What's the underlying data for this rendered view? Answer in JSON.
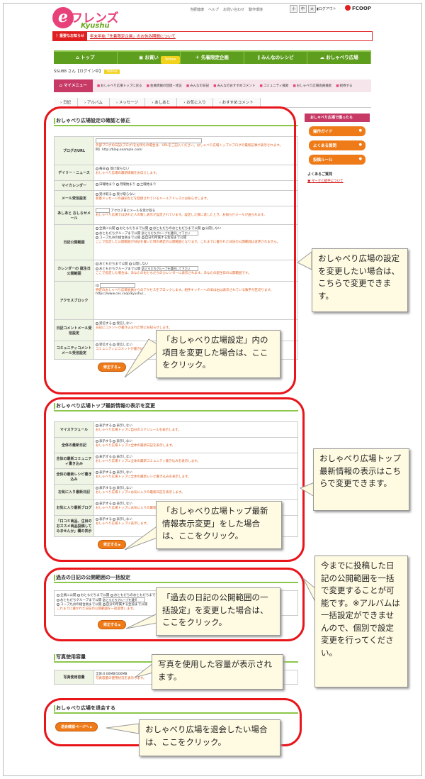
{
  "header": {
    "logo_text": "フレンズ",
    "logo_sub": "Kyushu",
    "top_links": [
      "当経健康",
      "ヘルプ",
      "お問い合わせ",
      "動作環境"
    ],
    "font_sizes": [
      "小",
      "中",
      "大"
    ],
    "logout": "ログアウト",
    "brand": "FCOOP"
  },
  "notice": {
    "label": "！重要なお知らせ",
    "text": "年末年始「先着限定企画」のお休み期間について"
  },
  "nav": {
    "items": [
      "トップ",
      "お買い",
      "先着限定企画",
      "みんなのレシピ",
      "おしゃべり広場"
    ],
    "badge": "Yellow"
  },
  "user": {
    "name": "SSU88 さん【ログイン中】",
    "badge": "Yellow"
  },
  "mymenu": {
    "label": "マイメニュー",
    "links": [
      "おしゃべり広場トップに戻る",
      "会員情報の登録・修正",
      "みんなの日記",
      "みんなのおすすめコメント",
      "コミュニティ検索",
      "おしゃべり広場会員検索",
      "招待する"
    ]
  },
  "tabs": [
    "日記",
    "アルバム",
    "メッセージ",
    "あしあと",
    "お気に入り",
    "おすすめコメント"
  ],
  "sec1": {
    "title": "おしゃべり広場設定の確認と修正",
    "rows": [
      {
        "label": "ブログのURL",
        "text": "外部ブログの日記(ブログ)をお持ちの場合は、URLをご記入ください。おしゃべり広場トップにブログの最新記事が表示されます。",
        "example": "例）http://blog.example.com/"
      },
      {
        "label": "デイリー・ニュース",
        "opts": [
          "毎日",
          "受け取らない"
        ],
        "text": "おしゃべり広場の最新情報をお伝えします。"
      },
      {
        "label": "マイカレンダー",
        "opts": [
          "日曜始まり",
          "月曜始まり",
          "土曜始まり"
        ],
        "text": ""
      },
      {
        "label": "メール受信設定",
        "opts": [
          "受け取る",
          "受け取らない"
        ],
        "text": "新着メッセージの通知などを登録されているメールアドレスにお知らせします。"
      },
      {
        "label": "あしあと おしらせメール",
        "text": "アクセス日にメールを受け取る",
        "note": "おしゃべり広場では訪れた人の数し表示が設定されています。設定した数に達したとき、お知らせメールが送られます。"
      },
      {
        "label": "日記公開範囲",
        "opts": [
          "全員に公開",
          "おともだちまで公開",
          "おともだちのおともだちまで公開",
          "公開しない",
          "おともだちグループまで公開",
          "コープ九州の組合員まで公開",
          "自分の所属する生協まで公開"
        ],
        "select": "おともだちグループを選択して下さい",
        "note": "ここで指定した公開範囲が日記を書いた時の規定の公開範囲となります。これまでに書かれた日記の公開範囲は変更されません。"
      },
      {
        "label": "カレンダーの 誕生日公開範囲",
        "opts": [
          "おともだちまで公開",
          "公開しない",
          "おともだちグループまで公開"
        ],
        "select": "おともだちグループを選択して下さい",
        "note": "ここで指定した場合は、あなたのおともだちのカレンダーに表示されます。あなたの誕生日の公開範囲です。"
      },
      {
        "label": "アクセスブロック",
        "text": "ID",
        "note": "特定のおしゃべり広場会員からのアクセスをブロックします。相手キッチーへのIDは右は表示されている数字が区切ります。",
        "example": "https://www.ces.coop/kyushu/..."
      },
      {
        "label": "日記コメントメール受信設定",
        "opts": [
          "受信する",
          "受信しない"
        ],
        "note": "日記にコメントが書き込まれた時にお知らせします。"
      },
      {
        "label": "コミュニティコメントメール受信設定",
        "opts": [
          "受信する",
          "受信しない"
        ],
        "note": "コミュニティにコメントが書き込まれた時にお知らせします。"
      }
    ],
    "button": "修正する"
  },
  "sec2": {
    "title": "おしゃべり広場トップ最新情報の表示を変更",
    "rows": [
      {
        "label": "マイスケジュール",
        "note": "おしゃべり広場トップに自分のスケジュールを表示します。"
      },
      {
        "label": "全体の最新日記",
        "note": "おしゃべり広場トップに全体の最新日記を表示します。"
      },
      {
        "label": "全体の最新コミュニティ書き込み",
        "note": "おしゃべり広場トップに全体の最新コミュニティ書き込みを表示します。"
      },
      {
        "label": "全体の最新レシピ書き込み",
        "note": "おしゃべり広場トップに全体の最新レシピ書き込みを表示します。"
      },
      {
        "label": "お気に入り最新日記",
        "note": "おしゃべり広場トップにお気に入りの最新日記を表示します。"
      },
      {
        "label": "お気に入り最新ブログ",
        "note": "おしゃべり広場トップにお気に入りの最新ブログを表示します。"
      },
      {
        "label": "「口コミ商品、注目のおススメ商品投稿してみませんか」欄の表示",
        "note": "おしゃべり広場トップに表示します。"
      }
    ],
    "opts": [
      "表示する",
      "表示しない"
    ],
    "button": "修正する"
  },
  "sec3": {
    "title": "過去の日記の公開範囲の一括設定",
    "opts1": [
      "全員に公開",
      "おともだちまで公開",
      "おともだちのおともだちまで公開"
    ],
    "opts2": [
      "おともだちグループまで公開"
    ],
    "select": "おともだちグループを選択",
    "opts3": [
      "コープ九州の組合員まで公開",
      "自分の所属する生協まで公開"
    ],
    "note": "これまでに書かれた日記の公開範囲を一括変更します。",
    "button": "修正する"
  },
  "sec4": {
    "title": "写真使用容量",
    "label": "写真使用容量",
    "value": "全体:0.00MB/500MB",
    "note": "写真容量の使用状況を表示します。"
  },
  "sec5": {
    "title": "おしゃべり広場を退会する",
    "button": "退会確認ページへ"
  },
  "sidebar": {
    "title": "おしゃべり広場で困ったら",
    "buttons": [
      "操作ガイド",
      "よくある質問",
      "投稿ルール"
    ],
    "faq_title": "よくあるご質問",
    "faq_link": "マークと絵手について"
  },
  "callouts": {
    "c1": "おしゃべり広場の設定を変更したい場合は、こちらで変更できます。",
    "c2": "「おしゃべり広場設定」内の項目を変更した場合は、ここをクリック。",
    "c3": "おしゃべり広場トップ最新情報の表示はこちらで変更できます。",
    "c4": "「おしゃべり広場トップ最新情報表示変更」をした場合は、ここをクリック。",
    "c5": "今までに投稿した日記の公開範囲を一括で変更することが可能です。※アルバムは一括設定ができませんので、個別で設定変更を行ってください。",
    "c6": "「過去の日記の公開範囲の一括設定」を変更した場合は、ここをクリック。",
    "c7": "写真を使用した容量が表示されます。",
    "c8": "おしゃべり広場を退会したい場合は、ここをクリック。"
  },
  "colors": {
    "accent_green": "#5e9e1e",
    "accent_pink": "#c73a66",
    "button_orange": "#ee7a18",
    "annotation_red": "#e8151b"
  }
}
